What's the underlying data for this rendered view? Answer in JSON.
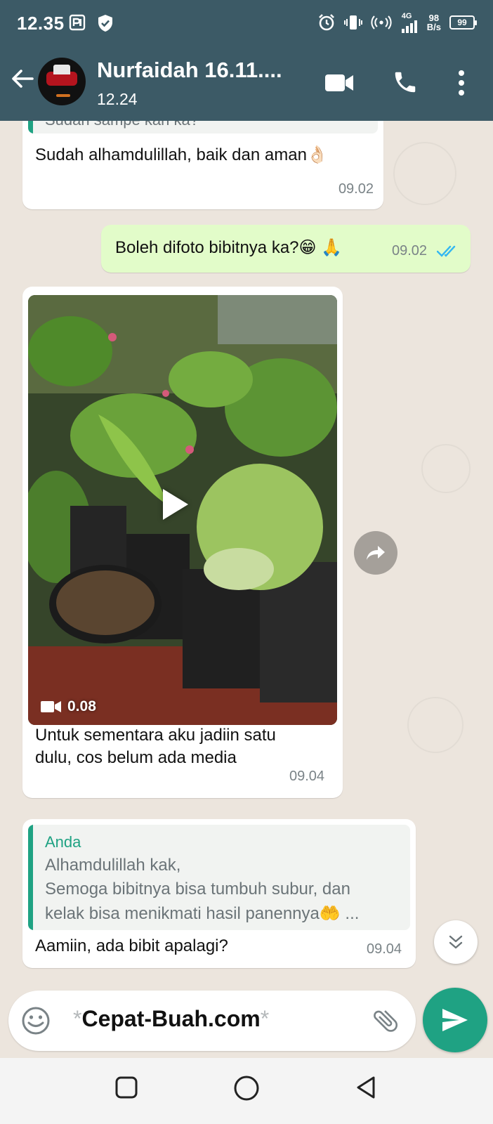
{
  "status_bar": {
    "time": "12.35",
    "network": "4G",
    "speed_value": "98",
    "speed_unit": "B/s",
    "battery": "99"
  },
  "header": {
    "contact_name": "Nurfaidah 16.11....",
    "subtitle": "12.24"
  },
  "messages": [
    {
      "direction": "incoming",
      "quote_preview": "Sudah sampe kah ka?",
      "text": "Sudah alhamdulillah, baik dan aman👌🏻",
      "time": "09.02"
    },
    {
      "direction": "outgoing",
      "text": "Boleh difoto bibitnya ka?😁 🙏",
      "time": "09.02",
      "receipt": "read"
    },
    {
      "direction": "incoming",
      "type": "video",
      "video_duration": "0.08",
      "caption_line1": "Untuk sementara aku jadiin satu",
      "caption_line2": "dulu, cos belum ada media",
      "time": "09.04"
    },
    {
      "direction": "incoming",
      "quote": {
        "author": "Anda",
        "line1": "Alhamdulillah kak,",
        "line2": "Semoga bibitnya bisa tumbuh subur, dan",
        "line3": "kelak bisa menikmati hasil panennya🤲 ..."
      },
      "text": "Aamiin, ada bibit apalagi?",
      "time": "09.04"
    }
  ],
  "composer": {
    "text": "Cepat-Buah.com",
    "prefix": "*",
    "suffix": "*"
  },
  "colors": {
    "header": "#3c5a66",
    "accent": "#1fa283",
    "chat_bg": "#ece5dd",
    "outgoing_bubble": "#e2fcc9",
    "read_ticks": "#34b7f1"
  },
  "icons": [
    "back-arrow-icon",
    "video-call-icon",
    "phone-icon",
    "more-vert-icon",
    "emoji-icon",
    "attach-icon",
    "send-icon",
    "forward-icon",
    "scroll-down-icon",
    "videocam-icon",
    "play-icon"
  ]
}
